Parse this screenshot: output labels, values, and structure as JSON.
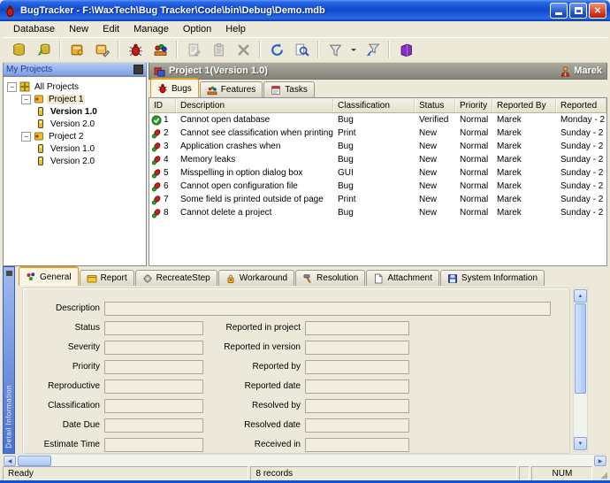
{
  "window": {
    "title": "BugTracker - F:\\WaxTech\\Bug Tracker\\Code\\bin\\Debug\\Demo.mdb",
    "app_icon": "bug",
    "controls": [
      "minimize",
      "maximize",
      "close"
    ]
  },
  "colors": {
    "titlebar_blue": "#1a54d8",
    "window_border": "#0f52dd",
    "chrome_beige": "#ece9d8",
    "active_tab_orange": "#e8a020",
    "panel_header_gray": "#8c8c80",
    "projects_header_blue": "#8aa8e8"
  },
  "menu": {
    "items": [
      "Database",
      "New",
      "Edit",
      "Manage",
      "Option",
      "Help"
    ]
  },
  "toolbar": {
    "buttons": [
      {
        "icon": "open-database"
      },
      {
        "icon": "detach-database"
      },
      {
        "separator": true
      },
      {
        "icon": "new-project"
      },
      {
        "icon": "edit-project"
      },
      {
        "separator": true
      },
      {
        "icon": "new-bug"
      },
      {
        "icon": "new-feature"
      },
      {
        "separator": true
      },
      {
        "icon": "edit-record",
        "disabled": true
      },
      {
        "icon": "view-record",
        "disabled": true
      },
      {
        "icon": "delete-record",
        "disabled": true
      },
      {
        "separator": true
      },
      {
        "icon": "refresh"
      },
      {
        "icon": "search"
      },
      {
        "separator": true
      },
      {
        "icon": "filter"
      },
      {
        "icon": "dropdown-arrow",
        "small": true
      },
      {
        "icon": "clear-filter"
      },
      {
        "separator": true
      },
      {
        "icon": "help"
      }
    ]
  },
  "projects_panel": {
    "title": "My Projects",
    "close_icon": "panel-close",
    "tree": [
      {
        "label": "All Projects",
        "depth": 0,
        "icon": "all-projects",
        "expander": true
      },
      {
        "label": "Project 1",
        "depth": 1,
        "icon": "project",
        "expander": true,
        "highlight": true
      },
      {
        "label": "Version 1.0",
        "depth": 2,
        "icon": "version",
        "bold": true
      },
      {
        "label": "Version 2.0",
        "depth": 2,
        "icon": "version"
      },
      {
        "label": "Project 2",
        "depth": 1,
        "icon": "project",
        "expander": true
      },
      {
        "label": "Version 1.0",
        "depth": 2,
        "icon": "version"
      },
      {
        "label": "Version 2.0",
        "depth": 2,
        "icon": "version"
      }
    ]
  },
  "project_header": {
    "title": "Project 1(Version 1.0)",
    "icon": "project-header",
    "user": "Marek",
    "user_icon": "user"
  },
  "module_tabs": [
    {
      "label": "Bugs",
      "icon": "bug-small",
      "active": true
    },
    {
      "label": "Features",
      "icon": "features-small",
      "active": false
    },
    {
      "label": "Tasks",
      "icon": "tasks-small",
      "active": false
    }
  ],
  "bug_table": {
    "columns": [
      "ID",
      "Description",
      "Classification",
      "Status",
      "Priority",
      "Reported By",
      "Reported"
    ],
    "rows": [
      {
        "icon": "verified",
        "id": "1",
        "description": "Cannot open database",
        "classification": "Bug",
        "status": "Verified",
        "priority": "Normal",
        "reported_by": "Marek",
        "reported": "Monday - 2"
      },
      {
        "icon": "bug-new",
        "id": "2",
        "description": "Cannot see classification when printing",
        "classification": "Print",
        "status": "New",
        "priority": "Normal",
        "reported_by": "Marek",
        "reported": "Sunday - 2"
      },
      {
        "icon": "bug-new",
        "id": "3",
        "description": "Application crashes when",
        "classification": "Bug",
        "status": "New",
        "priority": "Normal",
        "reported_by": "Marek",
        "reported": "Sunday - 2"
      },
      {
        "icon": "bug-new",
        "id": "4",
        "description": "Memory leaks",
        "classification": "Bug",
        "status": "New",
        "priority": "Normal",
        "reported_by": "Marek",
        "reported": "Sunday - 2"
      },
      {
        "icon": "bug-new",
        "id": "5",
        "description": "Misspelling in option dialog box",
        "classification": "GUI",
        "status": "New",
        "priority": "Normal",
        "reported_by": "Marek",
        "reported": "Sunday - 2"
      },
      {
        "icon": "bug-new",
        "id": "6",
        "description": "Cannot open configuration file",
        "classification": "Bug",
        "status": "New",
        "priority": "Normal",
        "reported_by": "Marek",
        "reported": "Sunday - 2"
      },
      {
        "icon": "bug-new",
        "id": "7",
        "description": "Some field is printed outside of page",
        "classification": "Print",
        "status": "New",
        "priority": "Normal",
        "reported_by": "Marek",
        "reported": "Sunday - 2"
      },
      {
        "icon": "bug-new",
        "id": "8",
        "description": "Cannot delete a project",
        "classification": "Bug",
        "status": "New",
        "priority": "Normal",
        "reported_by": "Marek",
        "reported": "Sunday - 2"
      }
    ]
  },
  "detail_panel": {
    "strip_label": "Detail Information",
    "tabs": [
      {
        "label": "General",
        "icon": "general",
        "active": true
      },
      {
        "label": "Report",
        "icon": "report",
        "active": false
      },
      {
        "label": "RecreateStep",
        "icon": "recreate-step",
        "active": false
      },
      {
        "label": "Workaround",
        "icon": "workaround",
        "active": false
      },
      {
        "label": "Resolution",
        "icon": "resolution",
        "active": false
      },
      {
        "label": "Attachment",
        "icon": "attachment",
        "active": false
      },
      {
        "label": "System Information",
        "icon": "system-information",
        "active": false
      }
    ],
    "fields_left": [
      {
        "label": "Description",
        "value": "",
        "wide": true
      },
      {
        "label": "Status",
        "value": ""
      },
      {
        "label": "Severity",
        "value": ""
      },
      {
        "label": "Priority",
        "value": ""
      },
      {
        "label": "Reproductive",
        "value": ""
      },
      {
        "label": "Classification",
        "value": ""
      },
      {
        "label": "Date Due",
        "value": ""
      },
      {
        "label": "Estimate Time",
        "value": ""
      }
    ],
    "fields_right": [
      {
        "label": "Reported in project",
        "value": ""
      },
      {
        "label": "Reported in version",
        "value": ""
      },
      {
        "label": "Reported by",
        "value": ""
      },
      {
        "label": "Reported date",
        "value": ""
      },
      {
        "label": "Resolved by",
        "value": ""
      },
      {
        "label": "Resolved date",
        "value": ""
      },
      {
        "label": "Received in",
        "value": ""
      }
    ]
  },
  "status_bar": {
    "left": "Ready",
    "center": "8 records",
    "right": "NUM"
  }
}
